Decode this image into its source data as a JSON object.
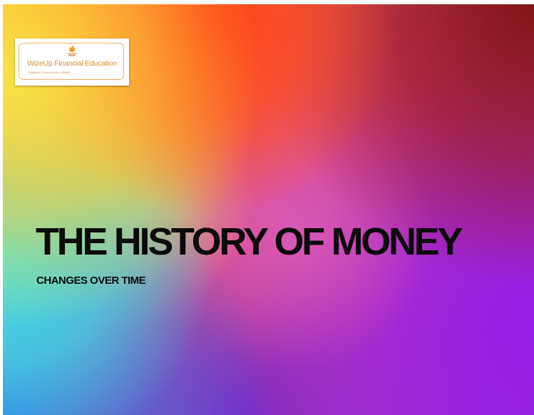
{
  "logo": {
    "icon": "flame-icon",
    "name": "WizeUp Financial Education",
    "subtext": "Registered Charity Number 1188699",
    "color": "#d98a30"
  },
  "slide": {
    "title": "THE HISTORY OF MONEY",
    "subtitle": "CHANGES OVER TIME",
    "text_color": "#0b0b0b"
  }
}
